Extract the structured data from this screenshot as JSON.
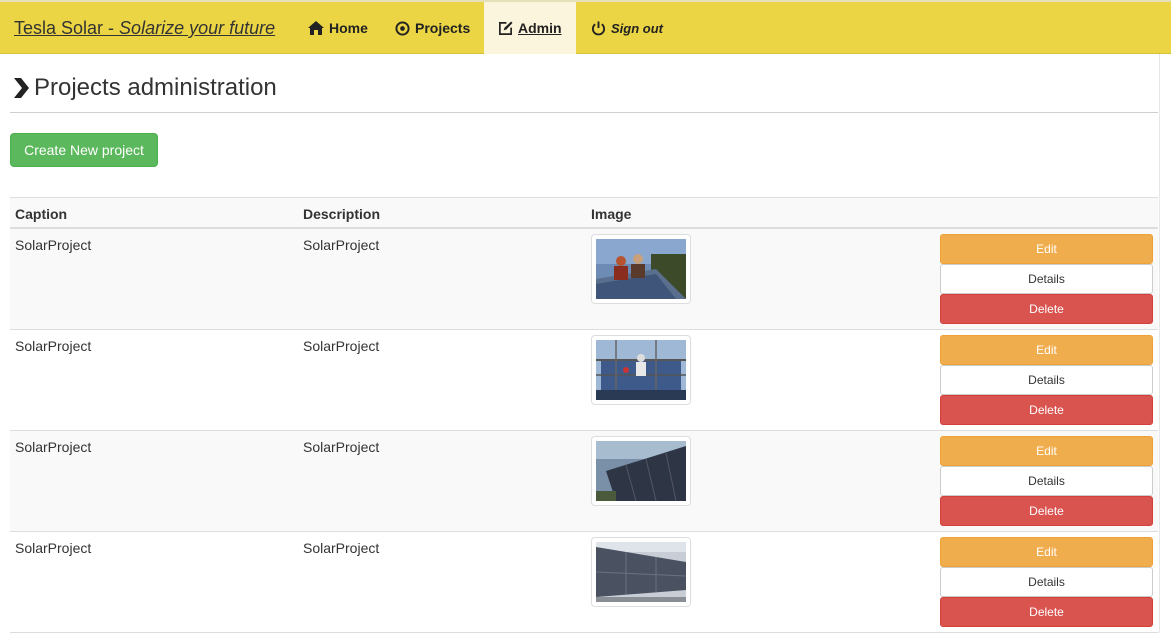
{
  "navbar": {
    "brand_prefix": "Tesla Solar - ",
    "brand_slogan": "Solarize your future",
    "items": [
      {
        "label": "Home",
        "icon": "home-icon"
      },
      {
        "label": "Projects",
        "icon": "target-icon"
      },
      {
        "label": "Admin",
        "icon": "edit-icon",
        "active": true
      },
      {
        "label": "Sign out",
        "icon": "power-icon"
      }
    ],
    "color": "#ebd544",
    "active_color": "#fcf5dd"
  },
  "page": {
    "title": "Projects administration",
    "title_icon": "chevron-right-icon",
    "create_button": "Create New project"
  },
  "table": {
    "headers": [
      "Caption",
      "Description",
      "Image"
    ],
    "rows": [
      {
        "caption": "SolarProject",
        "description": "SolarProject",
        "image": "workers-on-roof-photo"
      },
      {
        "caption": "SolarProject",
        "description": "SolarProject",
        "image": "scaffold-installation-photo"
      },
      {
        "caption": "SolarProject",
        "description": "SolarProject",
        "image": "solar-array-photo"
      },
      {
        "caption": "SolarProject",
        "description": "SolarProject",
        "image": "solar-wall-photo"
      }
    ],
    "actions": {
      "edit": "Edit",
      "details": "Details",
      "delete": "Delete"
    }
  },
  "colors": {
    "create": "#5cb85c",
    "edit": "#f0ad4e",
    "delete": "#d9534f"
  }
}
